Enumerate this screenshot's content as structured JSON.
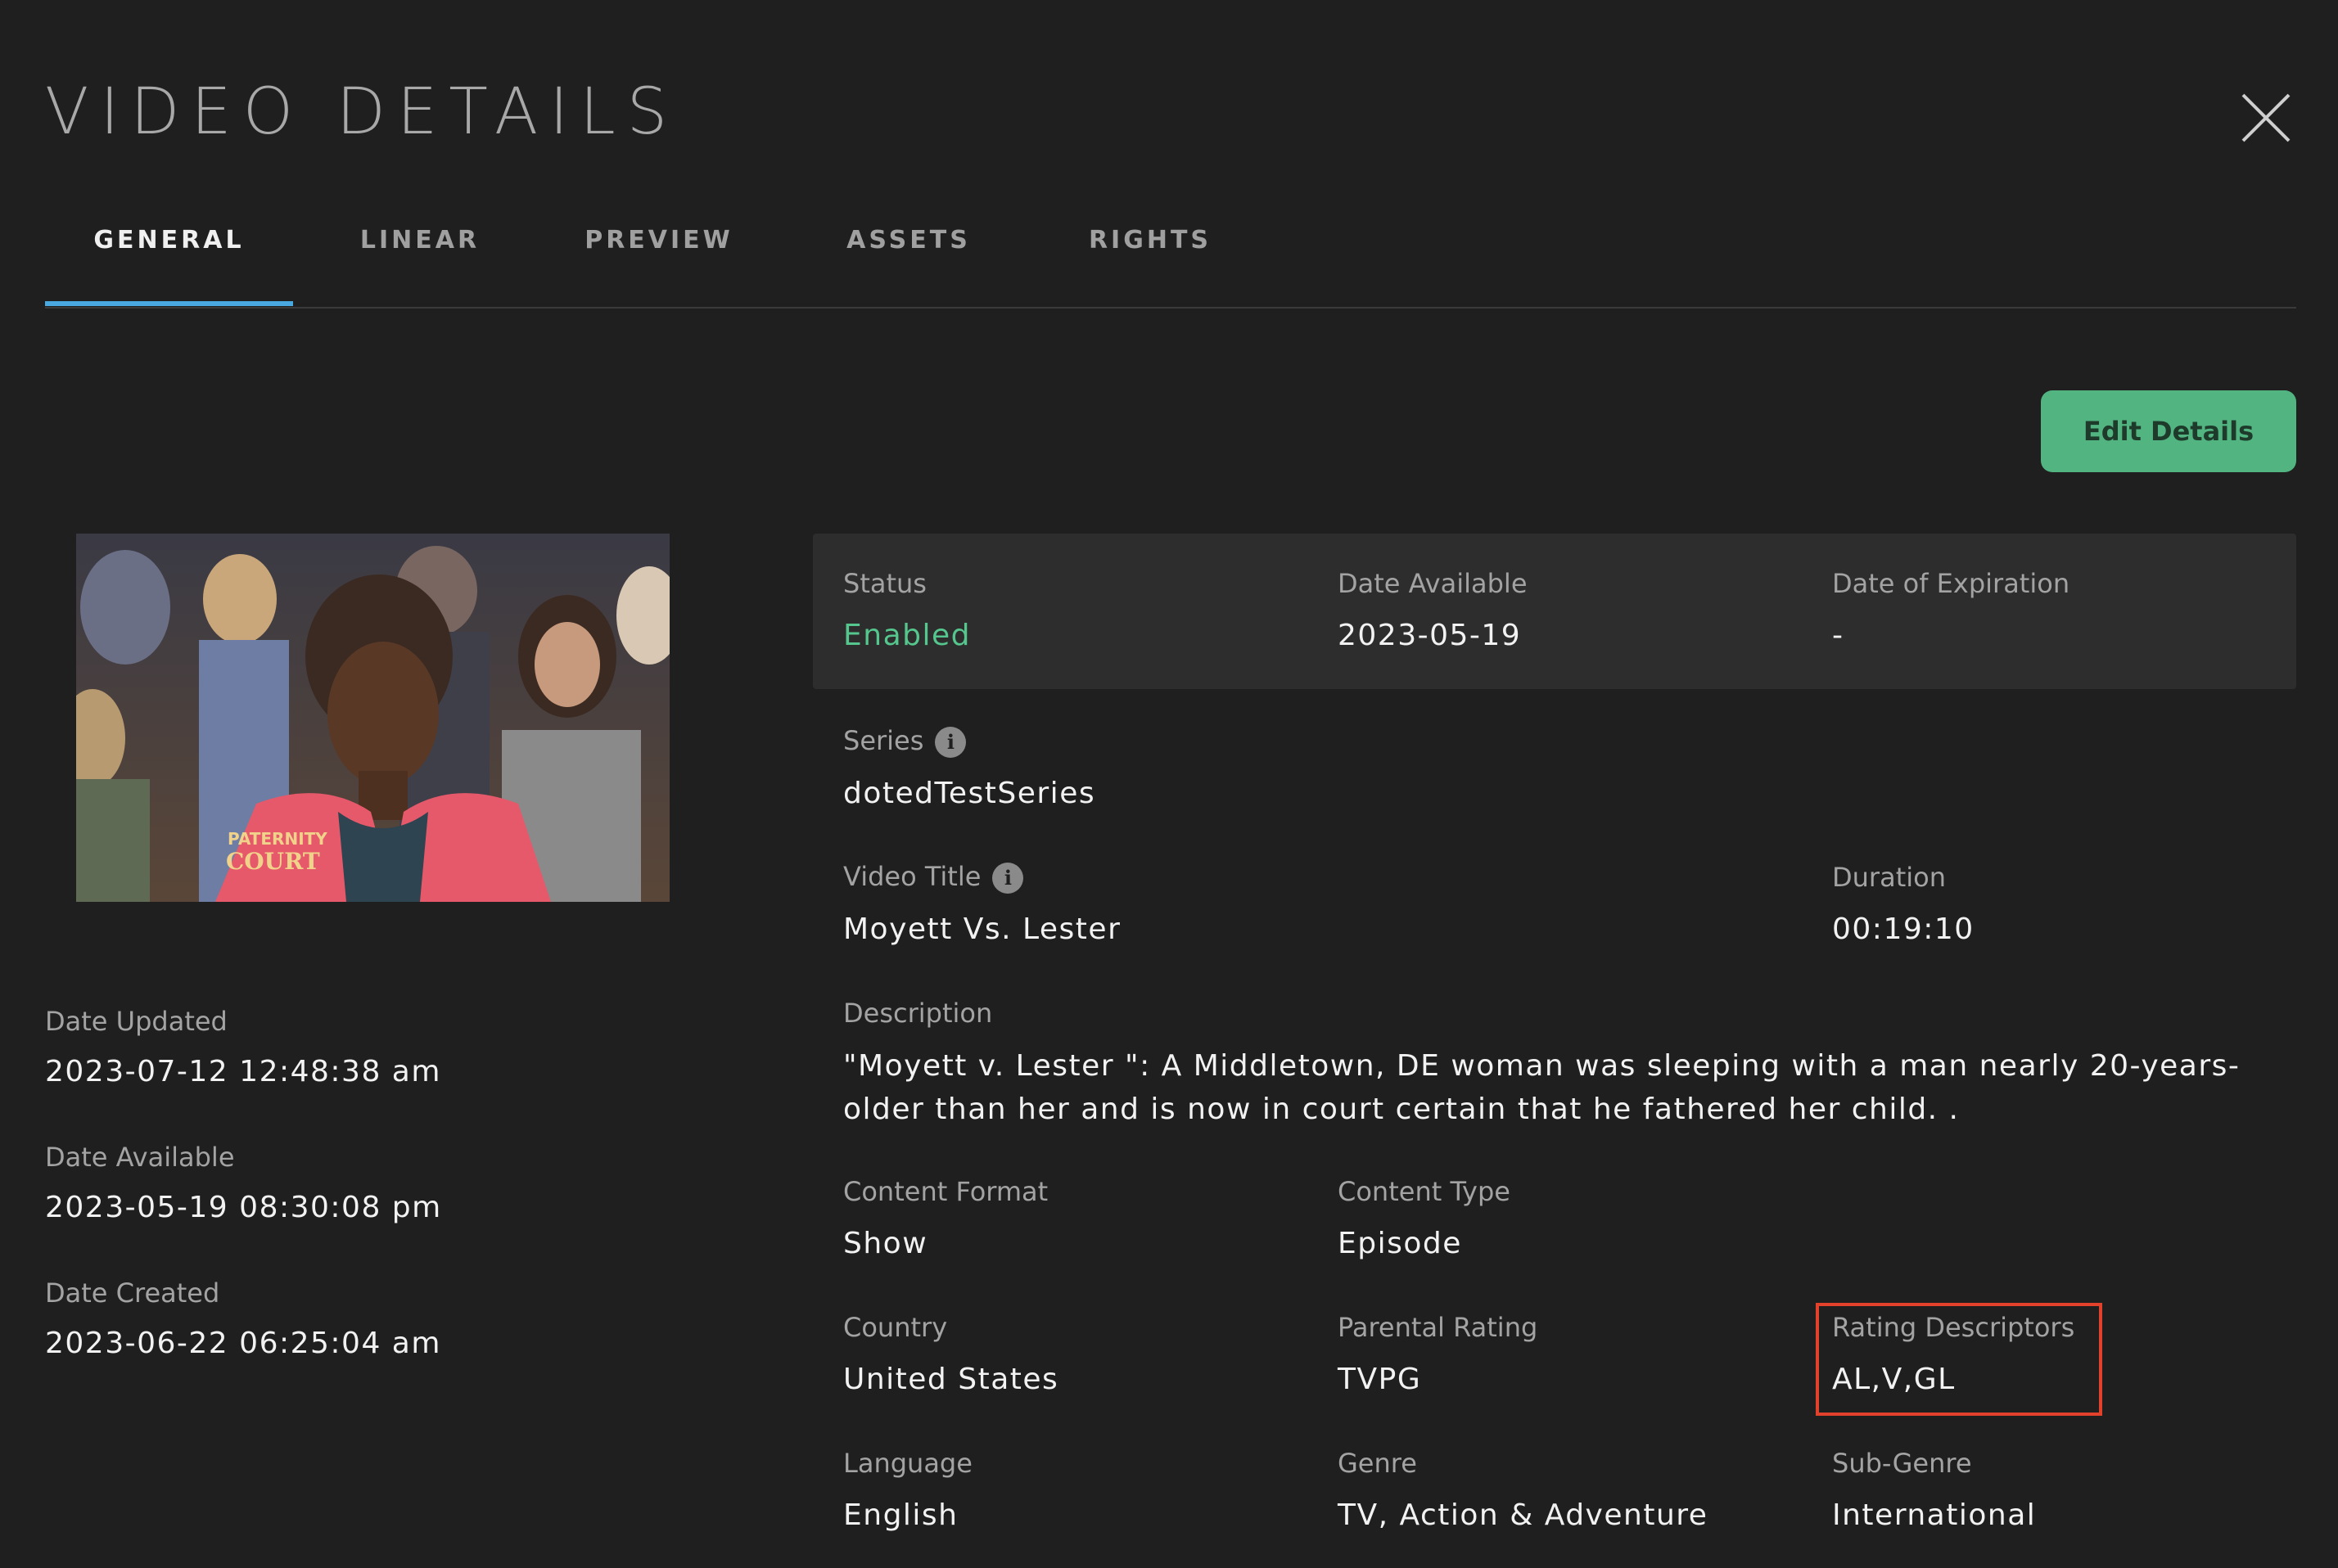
{
  "modal": {
    "title": "VIDEO DETAILS"
  },
  "tabs": [
    {
      "label": "GENERAL",
      "active": true
    },
    {
      "label": "LINEAR",
      "active": false
    },
    {
      "label": "PREVIEW",
      "active": false
    },
    {
      "label": "ASSETS",
      "active": false
    },
    {
      "label": "RIGHTS",
      "active": false
    }
  ],
  "actions": {
    "edit_label": "Edit Details"
  },
  "thumbnail": {
    "logo_line1": "PATERNITY",
    "logo_line2": "COURT"
  },
  "sidebar": {
    "date_updated": {
      "label": "Date Updated",
      "value": "2023-07-12 12:48:38 am"
    },
    "date_available": {
      "label": "Date Available",
      "value": "2023-05-19 08:30:08 pm"
    },
    "date_created": {
      "label": "Date Created",
      "value": "2023-06-22 06:25:04 am"
    }
  },
  "status_panel": {
    "status": {
      "label": "Status",
      "value": "Enabled"
    },
    "date_available": {
      "label": "Date Available",
      "value": "2023-05-19"
    },
    "date_expiration": {
      "label": "Date of Expiration",
      "value": "-"
    }
  },
  "fields": {
    "series": {
      "label": "Series",
      "value": "dotedTestSeries"
    },
    "video_title": {
      "label": "Video Title",
      "value": "Moyett Vs. Lester"
    },
    "duration": {
      "label": "Duration",
      "value": "00:19:10"
    },
    "description": {
      "label": "Description",
      "value": "\"Moyett v. Lester \": A Middletown, DE woman was sleeping with a man nearly 20-years-older than her and is now in court certain that he fathered her child. ."
    },
    "content_format": {
      "label": "Content Format",
      "value": "Show"
    },
    "content_type": {
      "label": "Content Type",
      "value": "Episode"
    },
    "country": {
      "label": "Country",
      "value": "United States"
    },
    "parental_rating": {
      "label": "Parental Rating",
      "value": "TVPG"
    },
    "rating_descriptors": {
      "label": "Rating Descriptors",
      "value": "AL,V,GL"
    },
    "language": {
      "label": "Language",
      "value": "English"
    },
    "genre": {
      "label": "Genre",
      "value": "TV, Action & Adventure"
    },
    "sub_genre": {
      "label": "Sub-Genre",
      "value": "International"
    }
  },
  "icons": {
    "info": "i",
    "close": "close-icon"
  },
  "colors": {
    "background": "#1f1f1f",
    "panel": "#2d2d2d",
    "accent_tab": "#4aa8e0",
    "button_green": "#52b581",
    "status_green": "#55c68d",
    "highlight_red": "#e2412c"
  }
}
